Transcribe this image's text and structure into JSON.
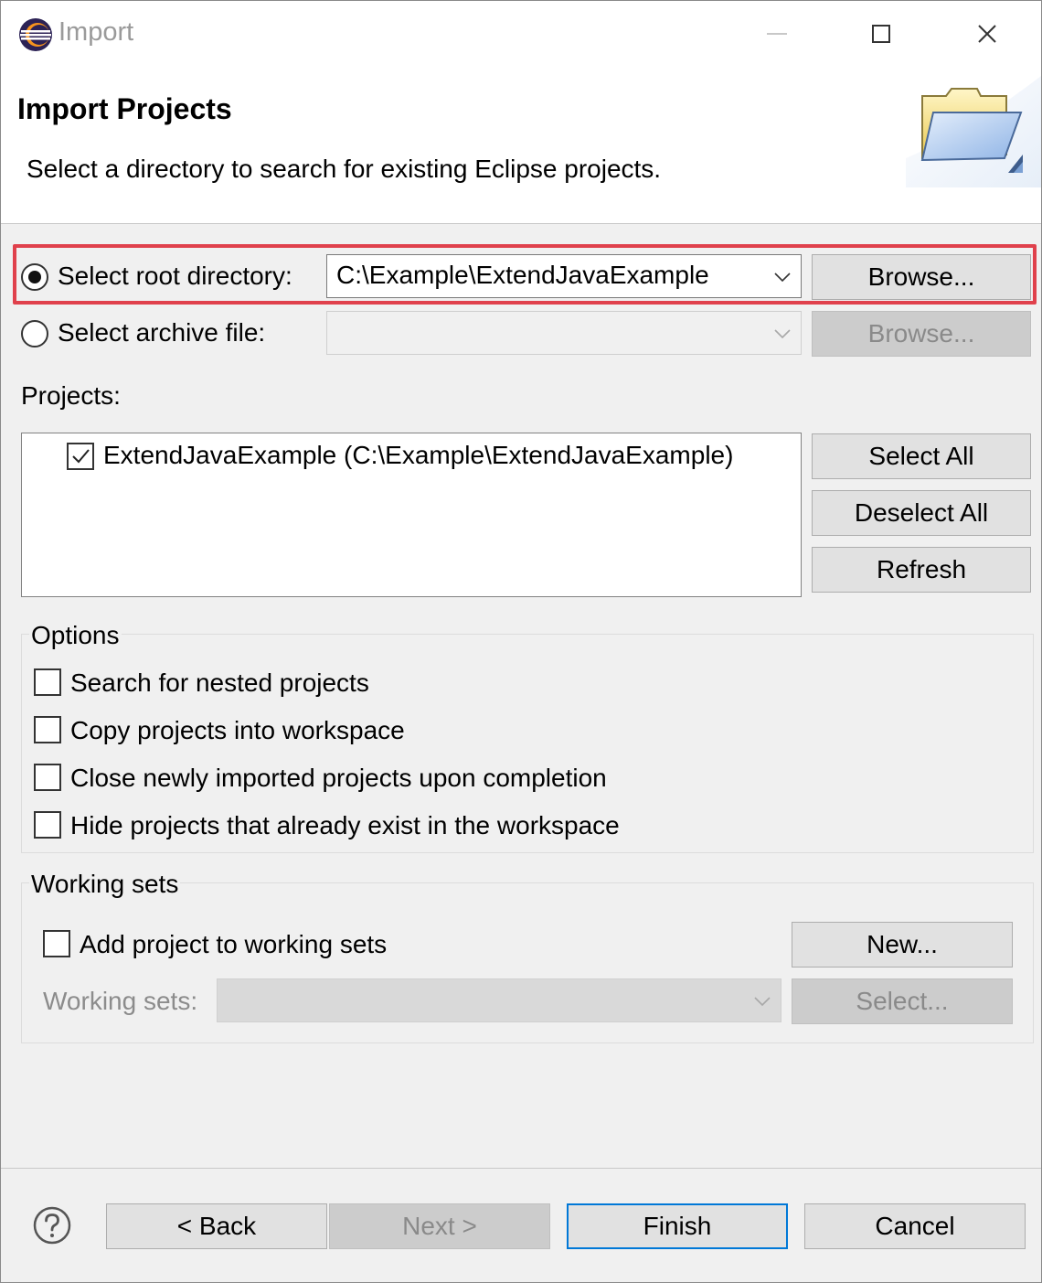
{
  "window": {
    "title": "Import"
  },
  "banner": {
    "title": "Import Projects",
    "description": "Select a directory to search for existing Eclipse projects."
  },
  "source": {
    "root_label": "Select root directory:",
    "root_selected": true,
    "root_path": "C:\\Example\\ExtendJavaExample",
    "root_browse": "Browse...",
    "archive_label": "Select archive file:",
    "archive_selected": false,
    "archive_path": "",
    "archive_browse": "Browse..."
  },
  "projects": {
    "label": "Projects:",
    "items": [
      {
        "label": "ExtendJavaExample (C:\\Example\\ExtendJavaExample)",
        "checked": true
      }
    ],
    "select_all": "Select All",
    "deselect_all": "Deselect All",
    "refresh": "Refresh"
  },
  "options": {
    "title": "Options",
    "items": [
      {
        "label": "Search for nested projects",
        "checked": false
      },
      {
        "label": "Copy projects into workspace",
        "checked": false
      },
      {
        "label": "Close newly imported projects upon completion",
        "checked": false
      },
      {
        "label": "Hide projects that already exist in the workspace",
        "checked": false
      }
    ]
  },
  "working_sets": {
    "title": "Working sets",
    "add_label": "Add project to working sets",
    "add_checked": false,
    "new_button": "New...",
    "sets_label": "Working sets:",
    "select_button": "Select..."
  },
  "footer": {
    "back": "< Back",
    "next": "Next >",
    "finish": "Finish",
    "cancel": "Cancel"
  },
  "colors": {
    "highlight": "#e0414c",
    "default_button_border": "#0078d7"
  }
}
